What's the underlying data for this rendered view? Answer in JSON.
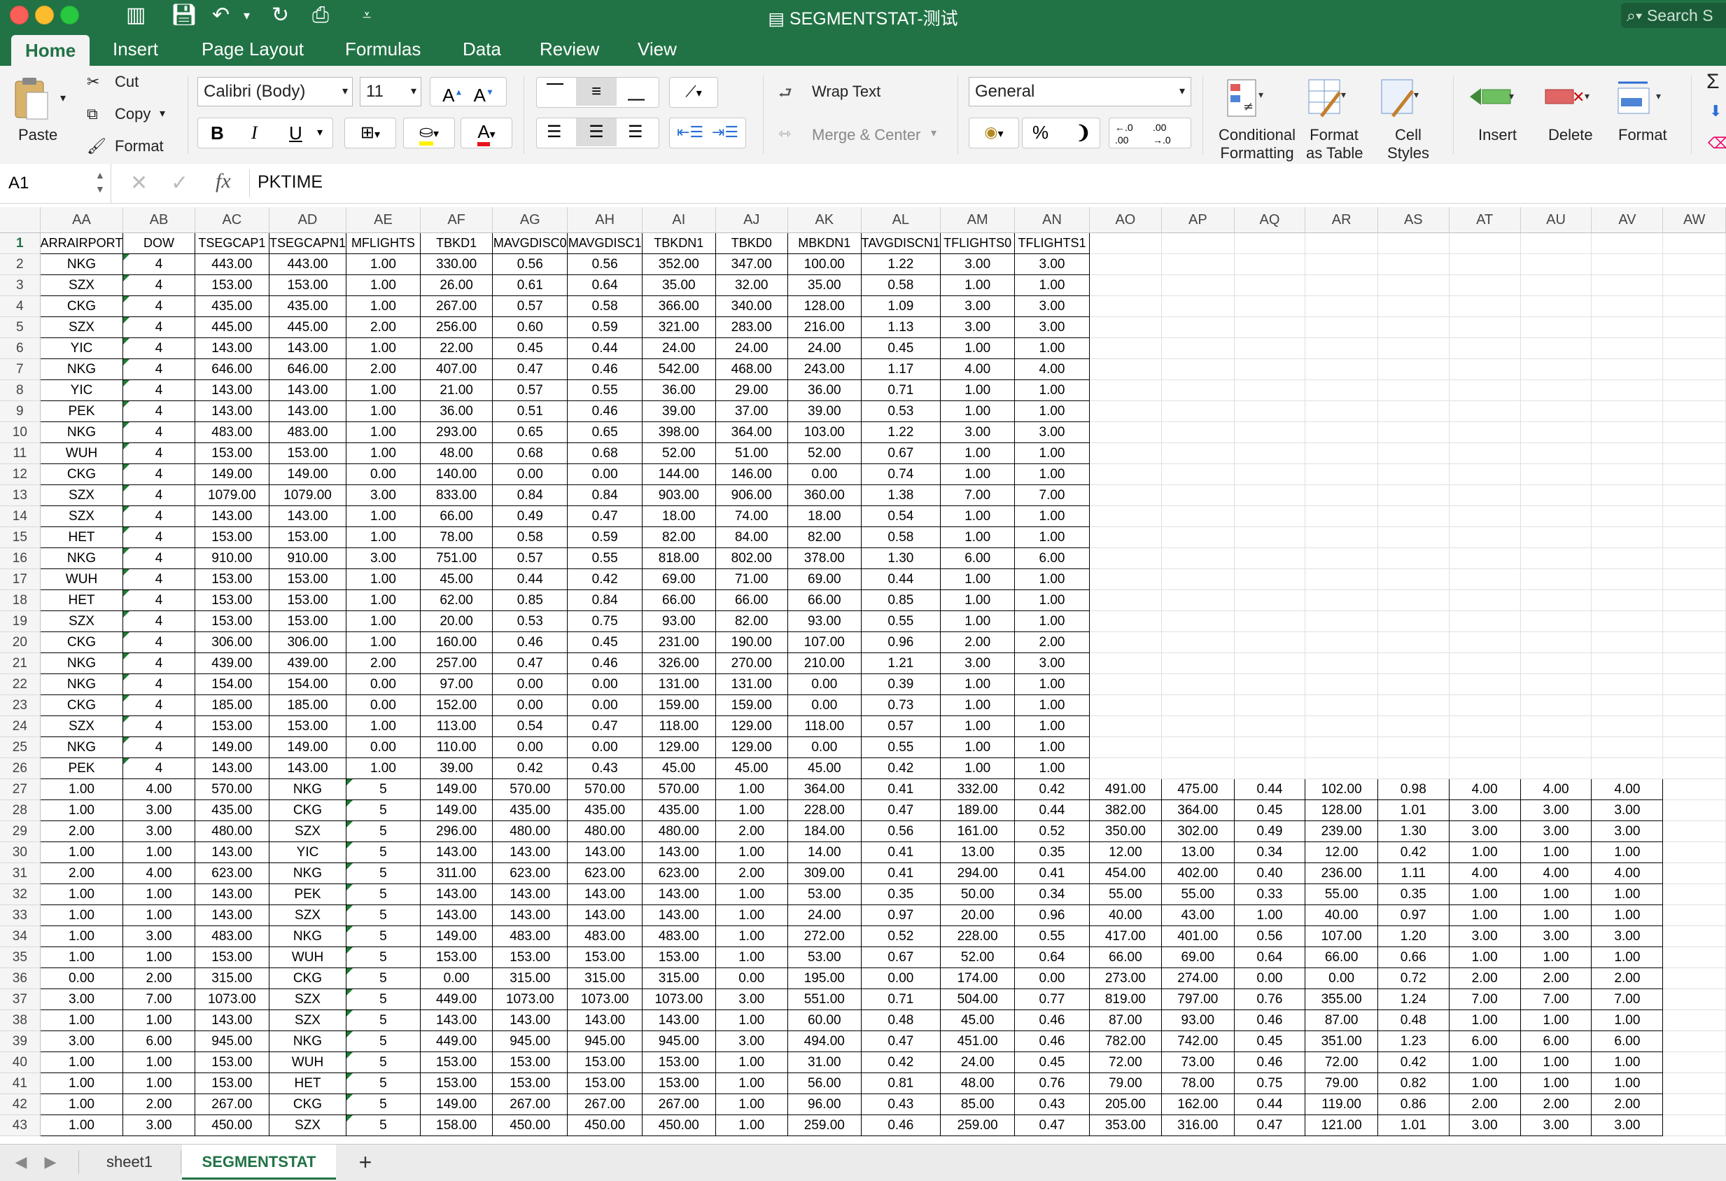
{
  "window": {
    "title": "SEGMENTSTAT-测试",
    "search_placeholder": "Search S"
  },
  "tabs": [
    "Home",
    "Insert",
    "Page Layout",
    "Formulas",
    "Data",
    "Review",
    "View"
  ],
  "ribbon": {
    "paste": "Paste",
    "cut": "Cut",
    "copy": "Copy",
    "format_painter": "Format",
    "font_name": "Calibri (Body)",
    "font_size": "11",
    "bold": "B",
    "italic": "I",
    "underline": "U",
    "wrap_text": "Wrap Text",
    "merge_center": "Merge & Center",
    "number_format": "General",
    "percent": "%",
    "comma": "❩",
    "inc_decimal": "←.0 .00",
    "dec_decimal": ".00 →.0",
    "conditional_formatting": [
      "Conditional",
      "Formatting"
    ],
    "format_as_table": [
      "Format",
      "as Table"
    ],
    "cell_styles": [
      "Cell",
      "Styles"
    ],
    "insert": "Insert",
    "delete": "Delete",
    "format": "Format"
  },
  "formula_bar": {
    "cell_ref": "A1",
    "fx": "fx",
    "value": "PKTIME"
  },
  "columns": [
    "AA",
    "AB",
    "AC",
    "AD",
    "AE",
    "AF",
    "AG",
    "AH",
    "AI",
    "AJ",
    "AK",
    "AL",
    "AM",
    "AN",
    "AO",
    "AP",
    "AQ",
    "AR",
    "AS",
    "AT",
    "AU",
    "AV",
    "AW"
  ],
  "header_row": [
    "ARRAIRPORT",
    "DOW",
    "TSEGCAP1",
    "TSEGCAPN1",
    "MFLIGHTS",
    "TBKD1",
    "MAVGDISC0",
    "MAVGDISC1",
    "TBKDN1",
    "TBKD0",
    "MBKDN1",
    "TAVGDISCN1",
    "TFLIGHTS0",
    "TFLIGHTS1"
  ],
  "rows_a": [
    [
      "NKG",
      "4",
      "443.00",
      "443.00",
      "1.00",
      "330.00",
      "0.56",
      "0.56",
      "352.00",
      "347.00",
      "100.00",
      "1.22",
      "3.00",
      "3.00"
    ],
    [
      "SZX",
      "4",
      "153.00",
      "153.00",
      "1.00",
      "26.00",
      "0.61",
      "0.64",
      "35.00",
      "32.00",
      "35.00",
      "0.58",
      "1.00",
      "1.00"
    ],
    [
      "CKG",
      "4",
      "435.00",
      "435.00",
      "1.00",
      "267.00",
      "0.57",
      "0.58",
      "366.00",
      "340.00",
      "128.00",
      "1.09",
      "3.00",
      "3.00"
    ],
    [
      "SZX",
      "4",
      "445.00",
      "445.00",
      "2.00",
      "256.00",
      "0.60",
      "0.59",
      "321.00",
      "283.00",
      "216.00",
      "1.13",
      "3.00",
      "3.00"
    ],
    [
      "YIC",
      "4",
      "143.00",
      "143.00",
      "1.00",
      "22.00",
      "0.45",
      "0.44",
      "24.00",
      "24.00",
      "24.00",
      "0.45",
      "1.00",
      "1.00"
    ],
    [
      "NKG",
      "4",
      "646.00",
      "646.00",
      "2.00",
      "407.00",
      "0.47",
      "0.46",
      "542.00",
      "468.00",
      "243.00",
      "1.17",
      "4.00",
      "4.00"
    ],
    [
      "YIC",
      "4",
      "143.00",
      "143.00",
      "1.00",
      "21.00",
      "0.57",
      "0.55",
      "36.00",
      "29.00",
      "36.00",
      "0.71",
      "1.00",
      "1.00"
    ],
    [
      "PEK",
      "4",
      "143.00",
      "143.00",
      "1.00",
      "36.00",
      "0.51",
      "0.46",
      "39.00",
      "37.00",
      "39.00",
      "0.53",
      "1.00",
      "1.00"
    ],
    [
      "NKG",
      "4",
      "483.00",
      "483.00",
      "1.00",
      "293.00",
      "0.65",
      "0.65",
      "398.00",
      "364.00",
      "103.00",
      "1.22",
      "3.00",
      "3.00"
    ],
    [
      "WUH",
      "4",
      "153.00",
      "153.00",
      "1.00",
      "48.00",
      "0.68",
      "0.68",
      "52.00",
      "51.00",
      "52.00",
      "0.67",
      "1.00",
      "1.00"
    ],
    [
      "CKG",
      "4",
      "149.00",
      "149.00",
      "0.00",
      "140.00",
      "0.00",
      "0.00",
      "144.00",
      "146.00",
      "0.00",
      "0.74",
      "1.00",
      "1.00"
    ],
    [
      "SZX",
      "4",
      "1079.00",
      "1079.00",
      "3.00",
      "833.00",
      "0.84",
      "0.84",
      "903.00",
      "906.00",
      "360.00",
      "1.38",
      "7.00",
      "7.00"
    ],
    [
      "SZX",
      "4",
      "143.00",
      "143.00",
      "1.00",
      "66.00",
      "0.49",
      "0.47",
      "18.00",
      "74.00",
      "18.00",
      "0.54",
      "1.00",
      "1.00"
    ],
    [
      "HET",
      "4",
      "153.00",
      "153.00",
      "1.00",
      "78.00",
      "0.58",
      "0.59",
      "82.00",
      "84.00",
      "82.00",
      "0.58",
      "1.00",
      "1.00"
    ],
    [
      "NKG",
      "4",
      "910.00",
      "910.00",
      "3.00",
      "751.00",
      "0.57",
      "0.55",
      "818.00",
      "802.00",
      "378.00",
      "1.30",
      "6.00",
      "6.00"
    ],
    [
      "WUH",
      "4",
      "153.00",
      "153.00",
      "1.00",
      "45.00",
      "0.44",
      "0.42",
      "69.00",
      "71.00",
      "69.00",
      "0.44",
      "1.00",
      "1.00"
    ],
    [
      "HET",
      "4",
      "153.00",
      "153.00",
      "1.00",
      "62.00",
      "0.85",
      "0.84",
      "66.00",
      "66.00",
      "66.00",
      "0.85",
      "1.00",
      "1.00"
    ],
    [
      "SZX",
      "4",
      "153.00",
      "153.00",
      "1.00",
      "20.00",
      "0.53",
      "0.75",
      "93.00",
      "82.00",
      "93.00",
      "0.55",
      "1.00",
      "1.00"
    ],
    [
      "CKG",
      "4",
      "306.00",
      "306.00",
      "1.00",
      "160.00",
      "0.46",
      "0.45",
      "231.00",
      "190.00",
      "107.00",
      "0.96",
      "2.00",
      "2.00"
    ],
    [
      "NKG",
      "4",
      "439.00",
      "439.00",
      "2.00",
      "257.00",
      "0.47",
      "0.46",
      "326.00",
      "270.00",
      "210.00",
      "1.21",
      "3.00",
      "3.00"
    ],
    [
      "NKG",
      "4",
      "154.00",
      "154.00",
      "0.00",
      "97.00",
      "0.00",
      "0.00",
      "131.00",
      "131.00",
      "0.00",
      "0.39",
      "1.00",
      "1.00"
    ],
    [
      "CKG",
      "4",
      "185.00",
      "185.00",
      "0.00",
      "152.00",
      "0.00",
      "0.00",
      "159.00",
      "159.00",
      "0.00",
      "0.73",
      "1.00",
      "1.00"
    ],
    [
      "SZX",
      "4",
      "153.00",
      "153.00",
      "1.00",
      "113.00",
      "0.54",
      "0.47",
      "118.00",
      "129.00",
      "118.00",
      "0.57",
      "1.00",
      "1.00"
    ],
    [
      "NKG",
      "4",
      "149.00",
      "149.00",
      "0.00",
      "110.00",
      "0.00",
      "0.00",
      "129.00",
      "129.00",
      "0.00",
      "0.55",
      "1.00",
      "1.00"
    ],
    [
      "PEK",
      "4",
      "143.00",
      "143.00",
      "1.00",
      "39.00",
      "0.42",
      "0.43",
      "45.00",
      "45.00",
      "45.00",
      "0.42",
      "1.00",
      "1.00"
    ]
  ],
  "rows_b": [
    [
      "1.00",
      "4.00",
      "570.00",
      "NKG",
      "5",
      "149.00",
      "570.00",
      "570.00",
      "570.00",
      "1.00",
      "364.00",
      "0.41",
      "332.00",
      "0.42",
      "491.00",
      "475.00",
      "0.44",
      "102.00",
      "0.98",
      "4.00",
      "4.00",
      "4.00"
    ],
    [
      "1.00",
      "3.00",
      "435.00",
      "CKG",
      "5",
      "149.00",
      "435.00",
      "435.00",
      "435.00",
      "1.00",
      "228.00",
      "0.47",
      "189.00",
      "0.44",
      "382.00",
      "364.00",
      "0.45",
      "128.00",
      "1.01",
      "3.00",
      "3.00",
      "3.00"
    ],
    [
      "2.00",
      "3.00",
      "480.00",
      "SZX",
      "5",
      "296.00",
      "480.00",
      "480.00",
      "480.00",
      "2.00",
      "184.00",
      "0.56",
      "161.00",
      "0.52",
      "350.00",
      "302.00",
      "0.49",
      "239.00",
      "1.30",
      "3.00",
      "3.00",
      "3.00"
    ],
    [
      "1.00",
      "1.00",
      "143.00",
      "YIC",
      "5",
      "143.00",
      "143.00",
      "143.00",
      "143.00",
      "1.00",
      "14.00",
      "0.41",
      "13.00",
      "0.35",
      "12.00",
      "13.00",
      "0.34",
      "12.00",
      "0.42",
      "1.00",
      "1.00",
      "1.00"
    ],
    [
      "2.00",
      "4.00",
      "623.00",
      "NKG",
      "5",
      "311.00",
      "623.00",
      "623.00",
      "623.00",
      "2.00",
      "309.00",
      "0.41",
      "294.00",
      "0.41",
      "454.00",
      "402.00",
      "0.40",
      "236.00",
      "1.11",
      "4.00",
      "4.00",
      "4.00"
    ],
    [
      "1.00",
      "1.00",
      "143.00",
      "PEK",
      "5",
      "143.00",
      "143.00",
      "143.00",
      "143.00",
      "1.00",
      "53.00",
      "0.35",
      "50.00",
      "0.34",
      "55.00",
      "55.00",
      "0.33",
      "55.00",
      "0.35",
      "1.00",
      "1.00",
      "1.00"
    ],
    [
      "1.00",
      "1.00",
      "143.00",
      "SZX",
      "5",
      "143.00",
      "143.00",
      "143.00",
      "143.00",
      "1.00",
      "24.00",
      "0.97",
      "20.00",
      "0.96",
      "40.00",
      "43.00",
      "1.00",
      "40.00",
      "0.97",
      "1.00",
      "1.00",
      "1.00"
    ],
    [
      "1.00",
      "3.00",
      "483.00",
      "NKG",
      "5",
      "149.00",
      "483.00",
      "483.00",
      "483.00",
      "1.00",
      "272.00",
      "0.52",
      "228.00",
      "0.55",
      "417.00",
      "401.00",
      "0.56",
      "107.00",
      "1.20",
      "3.00",
      "3.00",
      "3.00"
    ],
    [
      "1.00",
      "1.00",
      "153.00",
      "WUH",
      "5",
      "153.00",
      "153.00",
      "153.00",
      "153.00",
      "1.00",
      "53.00",
      "0.67",
      "52.00",
      "0.64",
      "66.00",
      "69.00",
      "0.64",
      "66.00",
      "0.66",
      "1.00",
      "1.00",
      "1.00"
    ],
    [
      "0.00",
      "2.00",
      "315.00",
      "CKG",
      "5",
      "0.00",
      "315.00",
      "315.00",
      "315.00",
      "0.00",
      "195.00",
      "0.00",
      "174.00",
      "0.00",
      "273.00",
      "274.00",
      "0.00",
      "0.00",
      "0.72",
      "2.00",
      "2.00",
      "2.00"
    ],
    [
      "3.00",
      "7.00",
      "1073.00",
      "SZX",
      "5",
      "449.00",
      "1073.00",
      "1073.00",
      "1073.00",
      "3.00",
      "551.00",
      "0.71",
      "504.00",
      "0.77",
      "819.00",
      "797.00",
      "0.76",
      "355.00",
      "1.24",
      "7.00",
      "7.00",
      "7.00"
    ],
    [
      "1.00",
      "1.00",
      "143.00",
      "SZX",
      "5",
      "143.00",
      "143.00",
      "143.00",
      "143.00",
      "1.00",
      "60.00",
      "0.48",
      "45.00",
      "0.46",
      "87.00",
      "93.00",
      "0.46",
      "87.00",
      "0.48",
      "1.00",
      "1.00",
      "1.00"
    ],
    [
      "3.00",
      "6.00",
      "945.00",
      "NKG",
      "5",
      "449.00",
      "945.00",
      "945.00",
      "945.00",
      "3.00",
      "494.00",
      "0.47",
      "451.00",
      "0.46",
      "782.00",
      "742.00",
      "0.45",
      "351.00",
      "1.23",
      "6.00",
      "6.00",
      "6.00"
    ],
    [
      "1.00",
      "1.00",
      "153.00",
      "WUH",
      "5",
      "153.00",
      "153.00",
      "153.00",
      "153.00",
      "1.00",
      "31.00",
      "0.42",
      "24.00",
      "0.45",
      "72.00",
      "73.00",
      "0.46",
      "72.00",
      "0.42",
      "1.00",
      "1.00",
      "1.00"
    ],
    [
      "1.00",
      "1.00",
      "153.00",
      "HET",
      "5",
      "153.00",
      "153.00",
      "153.00",
      "153.00",
      "1.00",
      "56.00",
      "0.81",
      "48.00",
      "0.76",
      "79.00",
      "78.00",
      "0.75",
      "79.00",
      "0.82",
      "1.00",
      "1.00",
      "1.00"
    ],
    [
      "1.00",
      "2.00",
      "267.00",
      "CKG",
      "5",
      "149.00",
      "267.00",
      "267.00",
      "267.00",
      "1.00",
      "96.00",
      "0.43",
      "85.00",
      "0.43",
      "205.00",
      "162.00",
      "0.44",
      "119.00",
      "0.86",
      "2.00",
      "2.00",
      "2.00"
    ],
    [
      "1.00",
      "3.00",
      "450.00",
      "SZX",
      "5",
      "158.00",
      "450.00",
      "450.00",
      "450.00",
      "1.00",
      "259.00",
      "0.46",
      "259.00",
      "0.47",
      "353.00",
      "316.00",
      "0.47",
      "121.00",
      "1.01",
      "3.00",
      "3.00",
      "3.00"
    ]
  ],
  "sheet_tabs": [
    "sheet1",
    "SEGMENTSTAT"
  ],
  "add_sheet": "+",
  "colors": {
    "excel_green": "#217346",
    "error_triangle": "#1e7b34"
  }
}
